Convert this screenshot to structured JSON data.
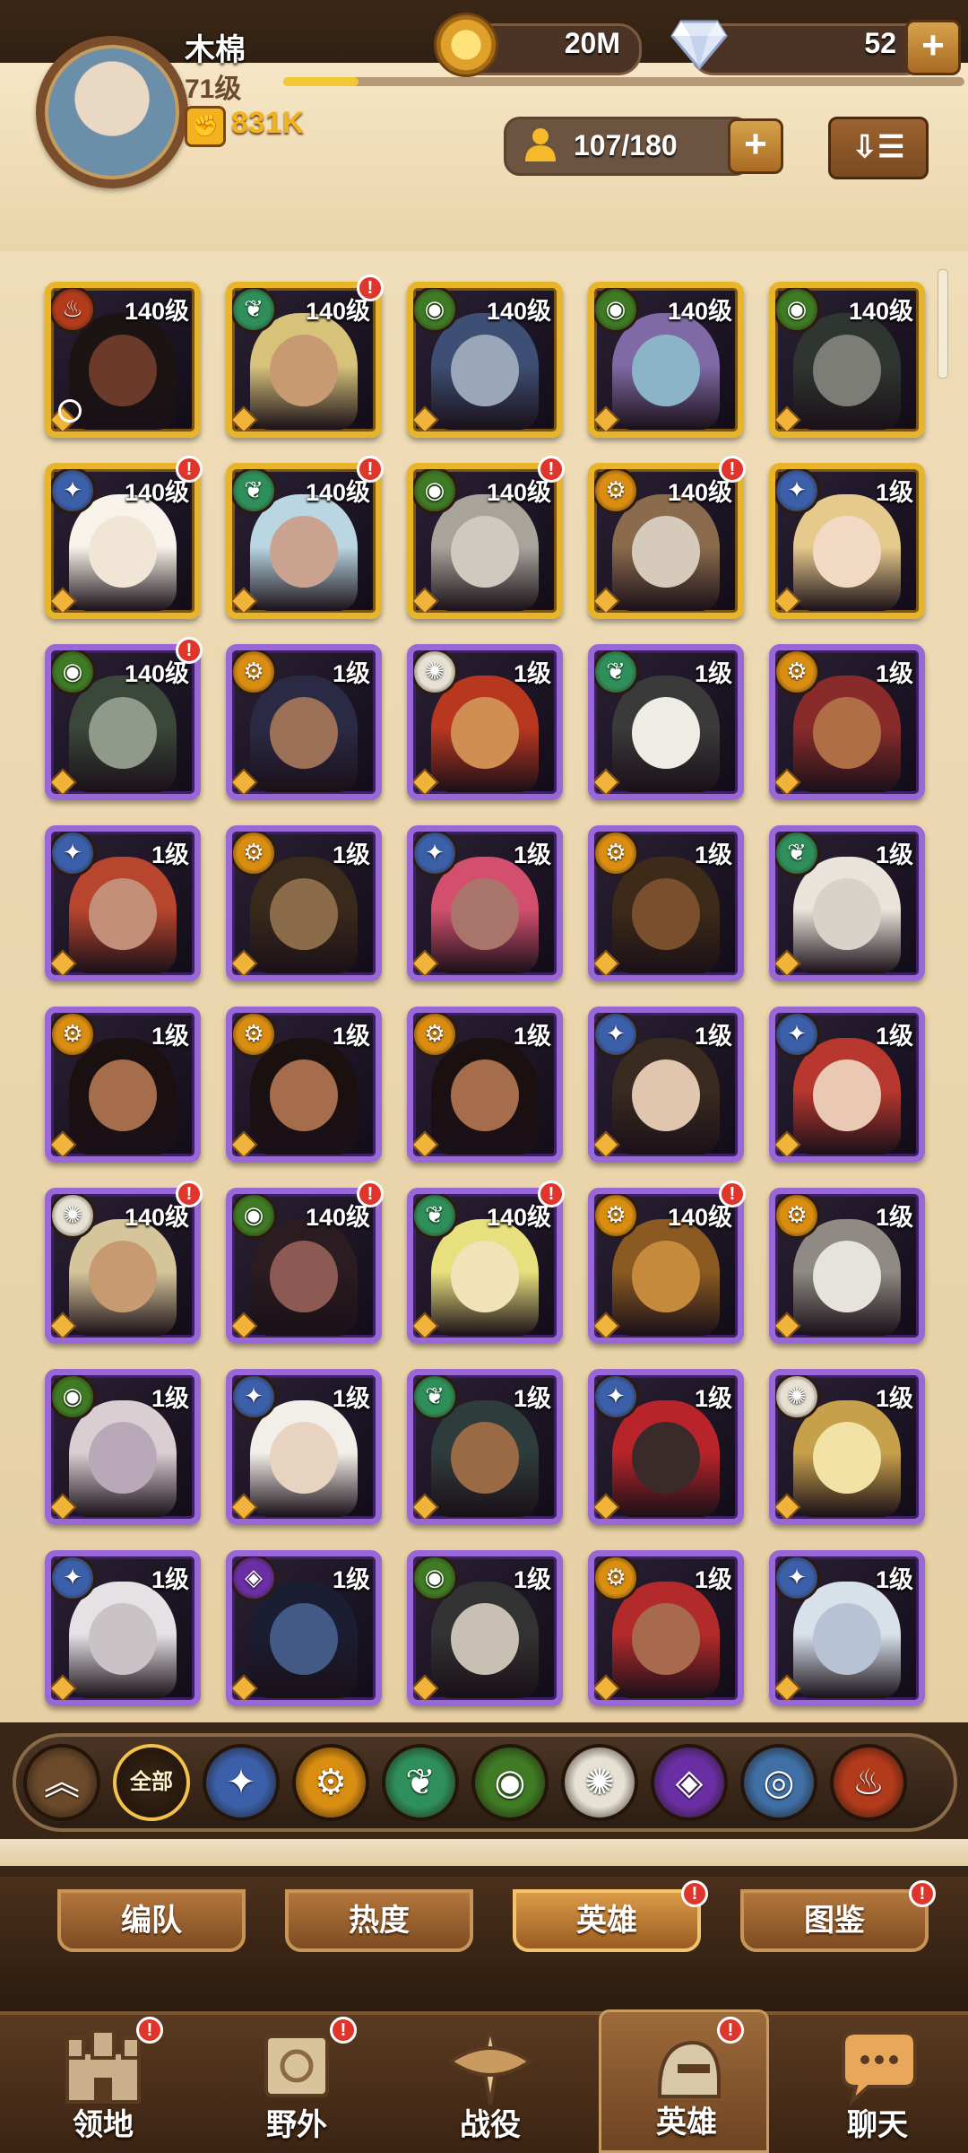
{
  "player": {
    "name": "木棉",
    "level": "71级",
    "xp_fraction": 0.11,
    "power": "831K"
  },
  "currency": {
    "gold": "20M",
    "gems": "52",
    "add_label": "+"
  },
  "roster": {
    "count": "107/180",
    "add_label": "+"
  },
  "sort_button": {
    "label": "⇩☰"
  },
  "colors": {
    "alert_red": "#e0352b",
    "level_max_frame": "#e8b52a",
    "epic_frame": "#9a67d6"
  },
  "factions": {
    "wilder": {
      "color": "#2f8f5a",
      "icon": "leaf-icon",
      "glyph": "❦"
    },
    "graveborn": {
      "color": "#3f7a24",
      "icon": "eye-icon",
      "glyph": "◉"
    },
    "lightbearer": {
      "color": "#3b5fa8",
      "icon": "star-icon",
      "glyph": "✦"
    },
    "mauler": {
      "color": "#b23b1c",
      "icon": "flame-icon",
      "glyph": "♨"
    },
    "celestial": {
      "color": "#e6e1d3",
      "icon": "sun-icon",
      "glyph": "✺"
    },
    "hypogean": {
      "color": "#6a2fa4",
      "icon": "void-icon",
      "glyph": "◈"
    },
    "dimensional": {
      "color": "#d98e12",
      "icon": "gear-icon",
      "glyph": "⚙"
    }
  },
  "heroes": [
    {
      "level": "140级",
      "faction": "mauler",
      "alert": false,
      "timer": true,
      "frame": "gold",
      "skin": "#6b3a2a",
      "hair": "#1c1412"
    },
    {
      "level": "140级",
      "faction": "wilder",
      "alert": true,
      "timer": false,
      "frame": "gold",
      "skin": "#c89a72",
      "hair": "#d7c27a"
    },
    {
      "level": "140级",
      "faction": "graveborn",
      "alert": false,
      "timer": false,
      "frame": "gold",
      "skin": "#9aa7b8",
      "hair": "#3d4f74"
    },
    {
      "level": "140级",
      "faction": "graveborn",
      "alert": false,
      "timer": false,
      "frame": "gold",
      "skin": "#8bb4c8",
      "hair": "#7f6aa6"
    },
    {
      "level": "140级",
      "faction": "graveborn",
      "alert": false,
      "timer": false,
      "frame": "gold",
      "skin": "#7c7d76",
      "hair": "#2f3631"
    },
    {
      "level": "140级",
      "faction": "lightbearer",
      "alert": true,
      "timer": false,
      "frame": "gold",
      "skin": "#f1e6d5",
      "hair": "#f7f3ea"
    },
    {
      "level": "140级",
      "faction": "wilder",
      "alert": true,
      "timer": false,
      "frame": "gold",
      "skin": "#c9a38f",
      "hair": "#b9d6e2"
    },
    {
      "level": "140级",
      "faction": "graveborn",
      "alert": true,
      "timer": false,
      "frame": "gold",
      "skin": "#cfc9c0",
      "hair": "#a8a49c"
    },
    {
      "level": "140级",
      "faction": "dimensional",
      "alert": true,
      "timer": false,
      "frame": "gold",
      "skin": "#d6cbbb",
      "hair": "#8b6b4d"
    },
    {
      "level": "1级",
      "faction": "lightbearer",
      "alert": false,
      "timer": false,
      "frame": "gold",
      "skin": "#f2d9c4",
      "hair": "#e6c98c"
    },
    {
      "level": "140级",
      "faction": "graveborn",
      "alert": true,
      "timer": false,
      "frame": "purple",
      "skin": "#8f9a8a",
      "hair": "#3b473b"
    },
    {
      "level": "1级",
      "faction": "dimensional",
      "alert": false,
      "timer": false,
      "frame": "purple",
      "skin": "#9c6f57",
      "hair": "#2b2a45"
    },
    {
      "level": "1级",
      "faction": "celestial",
      "alert": false,
      "timer": false,
      "frame": "purple",
      "skin": "#d08e52",
      "hair": "#b8371f"
    },
    {
      "level": "1级",
      "faction": "wilder",
      "alert": false,
      "timer": false,
      "frame": "purple",
      "skin": "#efece6",
      "hair": "#3a3a3a"
    },
    {
      "level": "1级",
      "faction": "dimensional",
      "alert": false,
      "timer": false,
      "frame": "purple",
      "skin": "#b06e46",
      "hair": "#8a2b2b"
    },
    {
      "level": "1级",
      "faction": "lightbearer",
      "alert": false,
      "timer": false,
      "frame": "purple",
      "skin": "#c38f78",
      "hair": "#b8452d"
    },
    {
      "level": "1级",
      "faction": "dimensional",
      "alert": false,
      "timer": false,
      "frame": "purple",
      "skin": "#8a6b4a",
      "hair": "#3a2a1c"
    },
    {
      "level": "1级",
      "faction": "lightbearer",
      "alert": false,
      "timer": false,
      "frame": "purple",
      "skin": "#a9756a",
      "hair": "#d2506e"
    },
    {
      "level": "1级",
      "faction": "dimensional",
      "alert": false,
      "timer": false,
      "frame": "purple",
      "skin": "#7a4f2e",
      "hair": "#3d2a18"
    },
    {
      "level": "1级",
      "faction": "wilder",
      "alert": false,
      "timer": false,
      "frame": "purple",
      "skin": "#d9d2ca",
      "hair": "#eae3db"
    },
    {
      "level": "1级",
      "faction": "dimensional",
      "alert": false,
      "timer": false,
      "frame": "purple",
      "skin": "#a56d4b",
      "hair": "#1b1010"
    },
    {
      "level": "1级",
      "faction": "dimensional",
      "alert": false,
      "timer": false,
      "frame": "purple",
      "skin": "#a56d4b",
      "hair": "#1b1010"
    },
    {
      "level": "1级",
      "faction": "dimensional",
      "alert": false,
      "timer": false,
      "frame": "purple",
      "skin": "#a56d4b",
      "hair": "#1b1010"
    },
    {
      "level": "1级",
      "faction": "lightbearer",
      "alert": false,
      "timer": false,
      "frame": "purple",
      "skin": "#e0c6ae",
      "hair": "#3a2b20"
    },
    {
      "level": "1级",
      "faction": "lightbearer",
      "alert": false,
      "timer": false,
      "frame": "purple",
      "skin": "#e9c9b4",
      "hair": "#b8372e"
    },
    {
      "level": "140级",
      "faction": "celestial",
      "alert": true,
      "timer": false,
      "frame": "purple",
      "skin": "#c89a72",
      "hair": "#d6c59a"
    },
    {
      "level": "140级",
      "faction": "graveborn",
      "alert": true,
      "timer": false,
      "frame": "purple",
      "skin": "#8c5a52",
      "hair": "#2a1c20"
    },
    {
      "level": "140级",
      "faction": "wilder",
      "alert": true,
      "timer": false,
      "frame": "purple",
      "skin": "#f2e2b8",
      "hair": "#e8df7e"
    },
    {
      "level": "140级",
      "faction": "dimensional",
      "alert": true,
      "timer": false,
      "frame": "purple",
      "skin": "#c68a3c",
      "hair": "#8a5a22"
    },
    {
      "level": "1级",
      "faction": "dimensional",
      "alert": false,
      "timer": false,
      "frame": "purple",
      "skin": "#e6e2dc",
      "hair": "#8f8a84"
    },
    {
      "level": "1级",
      "faction": "graveborn",
      "alert": false,
      "timer": false,
      "frame": "purple",
      "skin": "#b9a9b8",
      "hair": "#d9cfd3"
    },
    {
      "level": "1级",
      "faction": "lightbearer",
      "alert": false,
      "timer": false,
      "frame": "purple",
      "skin": "#e8d2c0",
      "hair": "#f2efe8"
    },
    {
      "level": "1级",
      "faction": "wilder",
      "alert": false,
      "timer": false,
      "frame": "purple",
      "skin": "#9a6a45",
      "hair": "#2f3c3c"
    },
    {
      "level": "1级",
      "faction": "lightbearer",
      "alert": false,
      "timer": false,
      "frame": "purple",
      "skin": "#3b2a2a",
      "hair": "#b8242a"
    },
    {
      "level": "1级",
      "faction": "celestial",
      "alert": false,
      "timer": false,
      "frame": "purple",
      "skin": "#f3e2a6",
      "hair": "#c7a04b"
    },
    {
      "level": "1级",
      "faction": "lightbearer",
      "alert": false,
      "timer": false,
      "frame": "purple",
      "skin": "#c9c3c6",
      "hair": "#e5e2e6"
    },
    {
      "level": "1级",
      "faction": "hypogean",
      "alert": false,
      "timer": false,
      "frame": "purple",
      "skin": "#445a86",
      "hair": "#1b1d33"
    },
    {
      "level": "1级",
      "faction": "graveborn",
      "alert": false,
      "timer": false,
      "frame": "purple",
      "skin": "#c8c0b3",
      "hair": "#333"
    },
    {
      "level": "1级",
      "faction": "dimensional",
      "alert": false,
      "timer": false,
      "frame": "purple",
      "skin": "#a76a4d",
      "hair": "#b32a2a"
    },
    {
      "level": "1级",
      "faction": "lightbearer",
      "alert": false,
      "timer": false,
      "frame": "purple",
      "skin": "#b7c2d4",
      "hair": "#d8e1ea"
    }
  ],
  "filters": [
    {
      "key": "tier",
      "icon": "chevron-up-icon",
      "glyph": "︽",
      "color": "#6b4a2b"
    },
    {
      "key": "all",
      "label": "全部"
    },
    {
      "key": "lightbearer",
      "icon": "star-icon",
      "glyph": "✦",
      "color": "#3b5fa8"
    },
    {
      "key": "dimensional",
      "icon": "gear-icon",
      "glyph": "⚙",
      "color": "#d98e12"
    },
    {
      "key": "wilder",
      "icon": "leaf-icon",
      "glyph": "❦",
      "color": "#2f8f5a"
    },
    {
      "key": "graveborn",
      "icon": "eye-icon",
      "glyph": "◉",
      "color": "#3f7a24"
    },
    {
      "key": "celestial",
      "icon": "sun-icon",
      "glyph": "✺",
      "color": "#e6e1d3"
    },
    {
      "key": "hypogean",
      "icon": "void-icon",
      "glyph": "◈",
      "color": "#6a2fa4"
    },
    {
      "key": "support",
      "icon": "shield-icon",
      "glyph": "◎",
      "color": "#3f6fa5"
    },
    {
      "key": "mauler",
      "icon": "flame-icon",
      "glyph": "♨",
      "color": "#b23b1c"
    }
  ],
  "sub_tabs": [
    {
      "label": "编队",
      "alert": false
    },
    {
      "label": "热度",
      "alert": false
    },
    {
      "label": "英雄",
      "alert": true,
      "active": true
    },
    {
      "label": "图鉴",
      "alert": true
    }
  ],
  "nav": [
    {
      "label": "领地",
      "icon": "castle-icon",
      "alert": true
    },
    {
      "label": "野外",
      "icon": "scroll-map-icon",
      "alert": true
    },
    {
      "label": "战役",
      "icon": "sword-emblem-icon",
      "alert": false
    },
    {
      "label": "英雄",
      "icon": "helmet-icon",
      "alert": true,
      "active": true
    },
    {
      "label": "聊天",
      "icon": "chat-bubble-icon",
      "alert": false
    }
  ]
}
